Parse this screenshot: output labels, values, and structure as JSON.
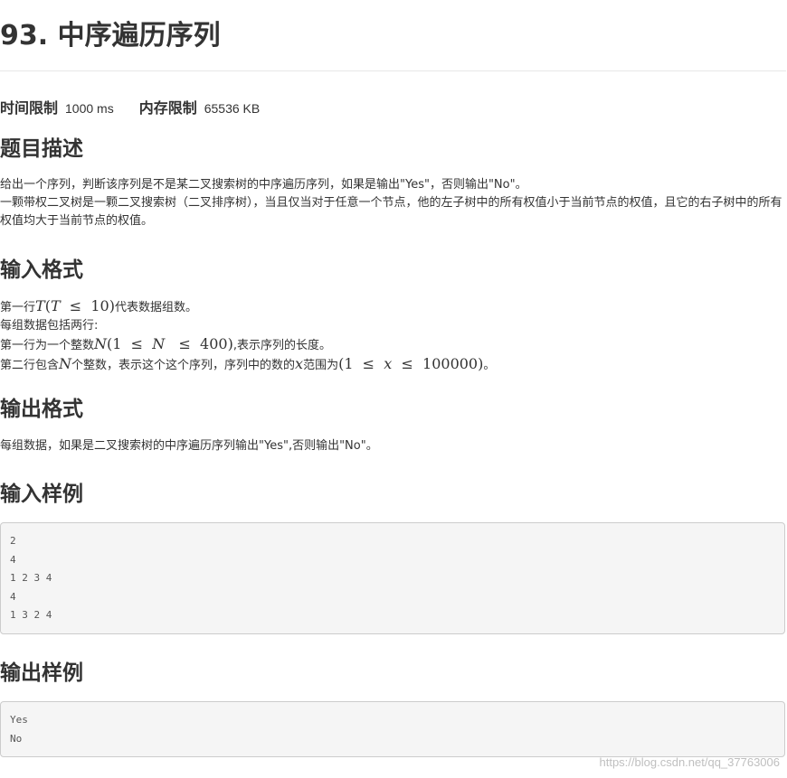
{
  "page": {
    "title": "93. 中序遍历序列"
  },
  "limits": {
    "time_label": "时间限制",
    "time_value": "1000 ms",
    "memory_label": "内存限制",
    "memory_value": "65536 KB"
  },
  "description": {
    "heading": "题目描述",
    "line1": "给出一个序列，判断该序列是不是某二叉搜索树的中序遍历序列，如果是输出\"Yes\"，否则输出\"No\"。",
    "line2": "一颗带权二叉树是一颗二叉搜索树（二叉排序树），当且仅当对于任意一个节点，他的左子树中的所有权值小于当前节点的权值，且它的右子树中的所有权值均大于当前节点的权值。"
  },
  "input_format": {
    "heading": "输入格式",
    "l1_pre": "第一行",
    "l1_post": "代表数据组数。",
    "l2": "每组数据包括两行:",
    "l3_pre": "第一行为一个整数",
    "l3_post": ",表示序列的长度。",
    "l4_pre": "第二行包含",
    "l4_mid1": "个整数，表示这个这个序列，序列中的数的",
    "l4_mid2": "范围为",
    "l4_post": "。"
  },
  "output_format": {
    "heading": "输出格式",
    "text": "每组数据，如果是二叉搜索树的中序遍历序列输出\"Yes\",否则输出\"No\"。"
  },
  "sample_input": {
    "heading": "输入样例",
    "lines": [
      "2",
      "4",
      "1 2 3 4",
      "4",
      "1 3 2 4"
    ]
  },
  "sample_output": {
    "heading": "输出样例",
    "lines": [
      "Yes",
      "No"
    ]
  },
  "watermark": "https://blog.csdn.net/qq_37763006"
}
